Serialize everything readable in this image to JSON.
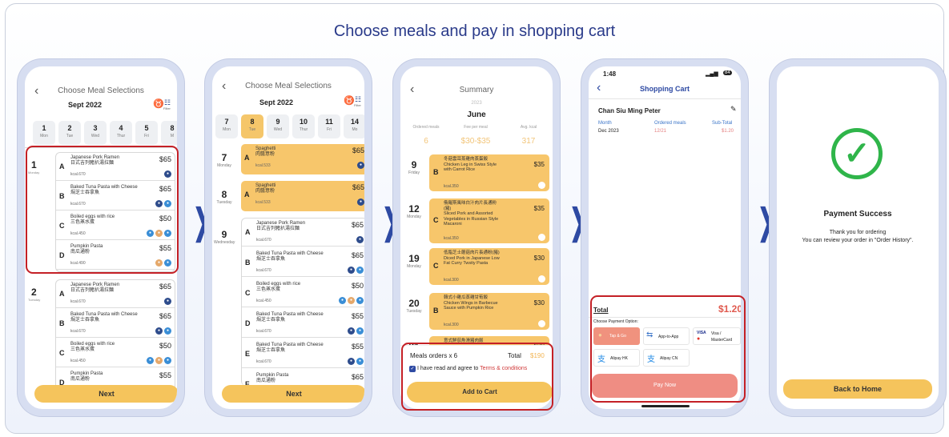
{
  "title": "Choose meals and pay in shopping cart",
  "arrow_glyph": "❯",
  "s1": {
    "header": "Choose Meal Selections",
    "month": "Sept 2022",
    "filter": "Filter",
    "days": [
      {
        "n": "1",
        "d": "Mon"
      },
      {
        "n": "2",
        "d": "Tue"
      },
      {
        "n": "3",
        "d": "Wed"
      },
      {
        "n": "4",
        "d": "Thur"
      },
      {
        "n": "5",
        "d": "Fri"
      },
      {
        "n": "8",
        "d": "M"
      }
    ],
    "g1": {
      "num": "1",
      "dow": "Monday"
    },
    "g2": {
      "num": "2",
      "dow": "Tuesday"
    },
    "meals": [
      {
        "letter": "A",
        "name": "Japanese Pork Ramen\n日式吉列豬扒湯拉麵",
        "kcal": "kcal.670",
        "price": "$65"
      },
      {
        "letter": "B",
        "name": "Baked Tuna Pasta with Cheese\n焗芝士吞拿魚",
        "kcal": "kcal.670",
        "price": "$65"
      },
      {
        "letter": "C",
        "name": "Boiled eggs with rice\n三色蒸水蛋",
        "kcal": "kcal.450",
        "price": "$50"
      },
      {
        "letter": "D",
        "name": "Pumpkin Pasta\n南瓜通粉",
        "kcal": "kcal.490",
        "price": "$55"
      }
    ],
    "meals2": [
      {
        "letter": "A",
        "name": "Japanese Pork Ramen\n日式吉列豬扒湯拉麵",
        "kcal": "kcal.670",
        "price": "$65"
      },
      {
        "letter": "B",
        "name": "Baked Tuna Pasta with Cheese\n焗芝士吞拿魚",
        "kcal": "kcal.670",
        "price": "$65"
      },
      {
        "letter": "C",
        "name": "Boiled eggs with rice\n三色蒸水蛋",
        "kcal": "kcal.450",
        "price": "$50"
      },
      {
        "letter": "D",
        "name": "Pumpkin Pasta\n南瓜通粉",
        "kcal": "",
        "price": "$55"
      }
    ],
    "next": "Next"
  },
  "s2": {
    "header": "Choose Meal Selections",
    "month": "Sept 2022",
    "filter": "Filter",
    "days": [
      {
        "n": "7",
        "d": "Mon"
      },
      {
        "n": "8",
        "d": "Tue"
      },
      {
        "n": "9",
        "d": "Wed"
      },
      {
        "n": "10",
        "d": "Thur"
      },
      {
        "n": "11",
        "d": "Fri"
      },
      {
        "n": "14",
        "d": "Mo"
      }
    ],
    "r7": {
      "num": "7",
      "dow": "Monday",
      "letter": "A",
      "name": "Spaghetti\n肉醬意粉",
      "kcal": "kcal.533",
      "price": "$65"
    },
    "r8": {
      "num": "8",
      "dow": "Tuesday",
      "letter": "A",
      "name": "Spaghetti\n肉醬意粉",
      "kcal": "kcal.533",
      "price": "$65"
    },
    "g9": {
      "num": "9",
      "dow": "Wednesday"
    },
    "meals": [
      {
        "letter": "A",
        "name": "Japanese Pork Ramen\n日式吉列豬扒湯拉麵",
        "kcal": "kcal.670",
        "price": "$65"
      },
      {
        "letter": "B",
        "name": "Baked Tuna Pasta with Cheese\n焗芝士吞拿魚",
        "kcal": "kcal.670",
        "price": "$65"
      },
      {
        "letter": "C",
        "name": "Boiled eggs with rice\n三色蒸水蛋",
        "kcal": "kcal.450",
        "price": "$50"
      },
      {
        "letter": "D",
        "name": "Baked Tuna Pasta with Cheese\n焗芝士吞拿魚",
        "kcal": "kcal.670",
        "price": "$55"
      },
      {
        "letter": "E",
        "name": "Baked Tuna Pasta with Cheese\n焗芝士吞拿魚",
        "kcal": "kcal.670",
        "price": "$55"
      },
      {
        "letter": "F",
        "name": "Pumpkin Pasta\n南瓜通粉",
        "kcal": "",
        "price": "$65"
      }
    ],
    "next": "Next"
  },
  "s3": {
    "header": "Summary",
    "year": "2023",
    "month": "June",
    "stats": [
      {
        "label": "Ordered meals",
        "value": "6"
      },
      {
        "label": "Fee per meal",
        "value": "$30-$35"
      },
      {
        "label": "Avg. kcal",
        "value": "317"
      }
    ],
    "items": [
      {
        "num": "9",
        "dow": "Friday",
        "letter": "B",
        "name": "冬菇雲耳蒸雞肉蒸蛋飯\nChicken Leg in Swiss Style\nwith Carrot Rice",
        "kcal": "kcal.350",
        "price": "$35"
      },
      {
        "num": "12",
        "dow": "Monday",
        "letter": "C",
        "name": "俄羅斯風味白汁肉片長通粉\n(豬)\nSliced Pork and Assorted\nVegetables in Russian Style\nMacaroni",
        "kcal": "kcal.350",
        "price": "$35"
      },
      {
        "num": "19",
        "dow": "Monday",
        "letter": "C",
        "name": "低脂芝士蘑菇肉片長通粉(豬)\nDiced Pork in Japanese Low\nFat Curry Twsity Pasta",
        "kcal": "kcal.300",
        "price": "$30"
      },
      {
        "num": "20",
        "dow": "Tuesday",
        "letter": "B",
        "name": "韓式小雞瓜蒸雞甘荀飯\nChicken Wings in Barbecue\nSauce with Pumpkin Rice",
        "kcal": "kcal.300",
        "price": "$30"
      },
      {
        "num": "21",
        "dow": "",
        "letter": "",
        "name": "意式鮮茄魚滑豬肉飯",
        "kcal": "",
        "price": "$30"
      }
    ],
    "orders": "Meals orders x 6",
    "total_label": "Total",
    "total": "$190",
    "agree": "I have read and agree to ",
    "terms": "Terms & conditions",
    "add": "Add to Cart"
  },
  "s4": {
    "time": "1:48",
    "battery": "84",
    "header": "Shopping Cart",
    "name": "Chan Siu Ming Peter",
    "cols": [
      "Month",
      "Ordered meals",
      "Sub-Total"
    ],
    "row": [
      "Dec 2023",
      "12/21",
      "$1.20"
    ],
    "total_label": "Total",
    "total": "$1.20",
    "pay_opt": "Choose Payment Option:",
    "methods": [
      "Tap & Go",
      "App-to-App",
      "Visa /\nMasterCard",
      "Alipay HK",
      "Alipay CN"
    ],
    "visa": "VISA",
    "pay": "Pay Now"
  },
  "s5": {
    "title": "Payment Success",
    "msg1": "Thank you for ordering",
    "msg2": "You can review your order in \"Order History\".",
    "btn": "Back to Home"
  }
}
